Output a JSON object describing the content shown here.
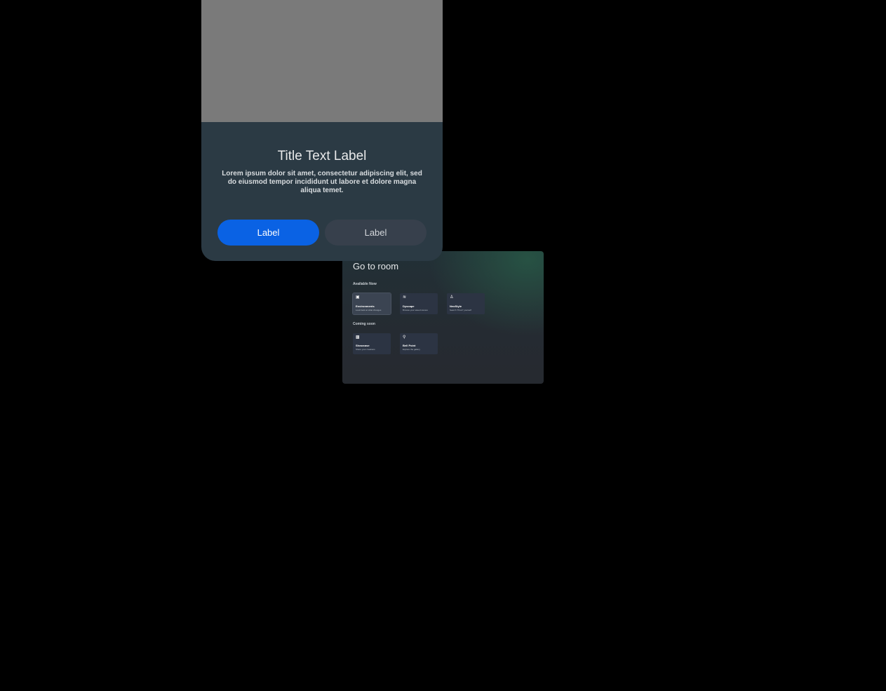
{
  "dialog": {
    "title": "Title Text Label",
    "body": "Lorem ipsum dolor sit amet, consectetur adipiscing elit, sed do eiusmod tempor incididunt ut labore et dolore magna aliqua temet.",
    "primary_label": "Label",
    "secondary_label": "Label",
    "image_color": "#7a7a7a",
    "primary_color": "#0a62e4"
  },
  "room_panel": {
    "title": "Go to room",
    "available_heading": "Available Now",
    "available": [
      {
        "icon": "landscape-icon",
        "glyph": "▣",
        "name": "Environments",
        "desc": "Look back at what changes"
      },
      {
        "icon": "layers-icon",
        "glyph": "≋",
        "name": "Dyscape",
        "desc": "Browse your saved scenes"
      },
      {
        "icon": "figure-icon",
        "glyph": "♙",
        "name": "NeoStyle",
        "desc": "Search \"Prest\" yourself"
      }
    ],
    "coming_heading": "Coming soon",
    "coming": [
      {
        "icon": "gamepad-icon",
        "glyph": "▩",
        "name": "Showcase",
        "desc": "Share your creations"
      },
      {
        "icon": "location-pin-icon",
        "glyph": "⚲",
        "name": "Bell Point",
        "desc": "Explore the gallery"
      }
    ]
  }
}
